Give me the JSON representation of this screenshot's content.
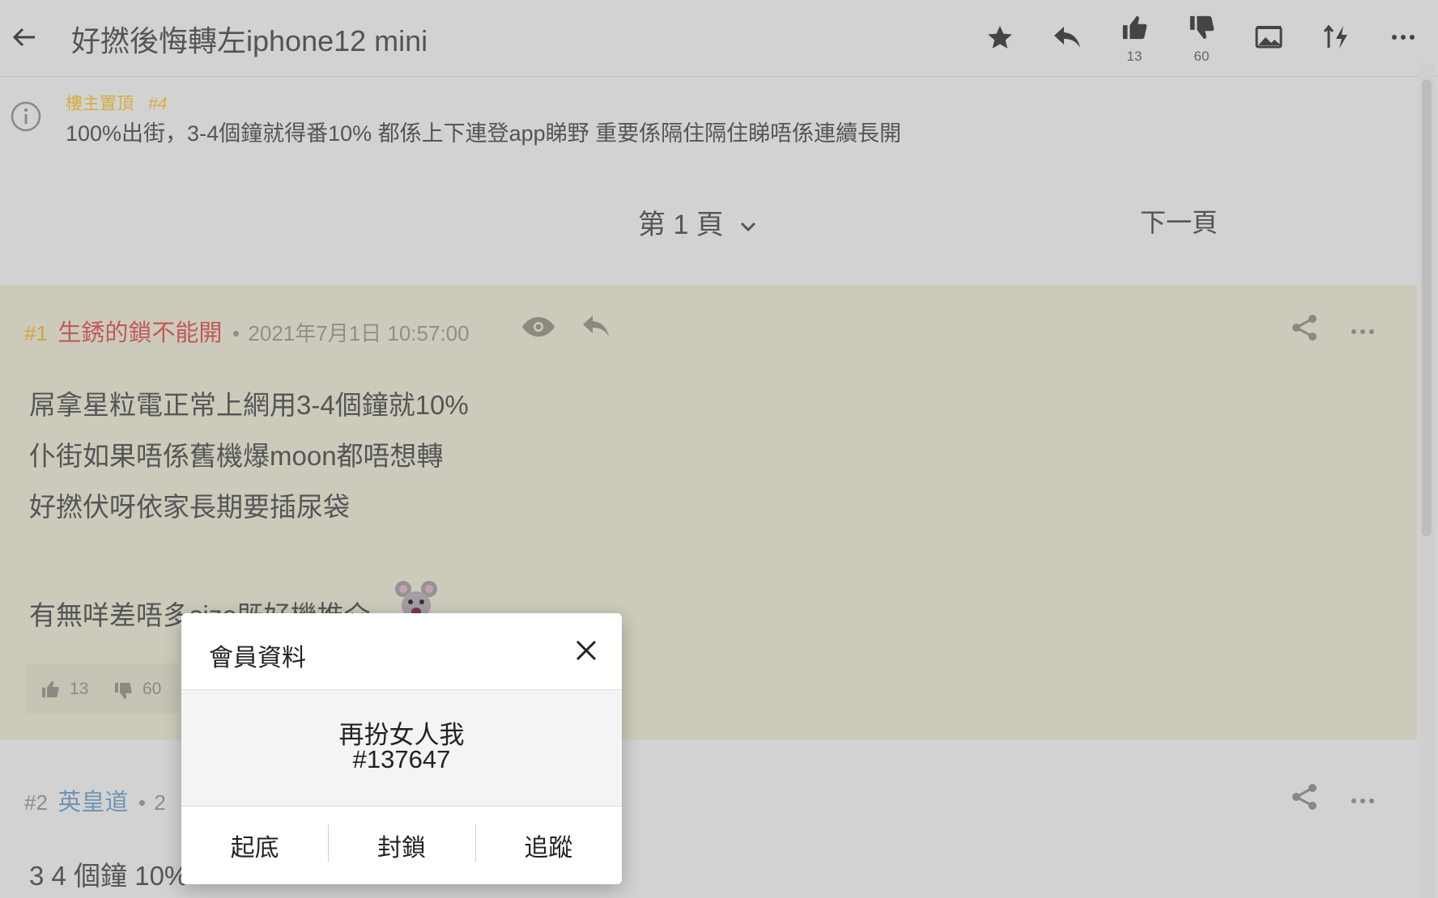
{
  "header": {
    "title": "好撚後悔轉左iphone12 mini",
    "likes": "13",
    "dislikes": "60"
  },
  "pinned": {
    "tag": "樓主置頂",
    "ref": "#4",
    "text": "100%出街，3-4個鐘就得番10% 都係上下連登app睇野 重要係隔住隔住睇唔係連續長開"
  },
  "pagination": {
    "current": "第 1 頁",
    "next": "下一頁"
  },
  "posts": [
    {
      "number": "#1",
      "author": "生銹的鎖不能開",
      "timestamp": "2021年7月1日 10:57:00",
      "lines": [
        "屌拿星粒電正常上網用3-4個鐘就10%",
        "仆街如果唔係舊機爆moon都唔想轉",
        "好撚伏呀依家長期要插尿袋",
        "有無咩差唔多size既好機推介"
      ],
      "likes": "13",
      "dislikes": "60"
    },
    {
      "number": "#2",
      "author": "英皇道",
      "timestamp_partial": "2",
      "lines": [
        "3 4 個鐘 10%"
      ]
    }
  ],
  "modal": {
    "title": "會員資料",
    "username": "再扮女人我",
    "user_id": "#137647",
    "actions": [
      "起底",
      "封鎖",
      "追蹤"
    ]
  },
  "colors": {
    "pinned_tag": "#d6ad3a",
    "op_number": "#d7a238",
    "author1": "#c05a5a",
    "author2": "#6f94b4",
    "post1_bg": "#cccbbb"
  }
}
